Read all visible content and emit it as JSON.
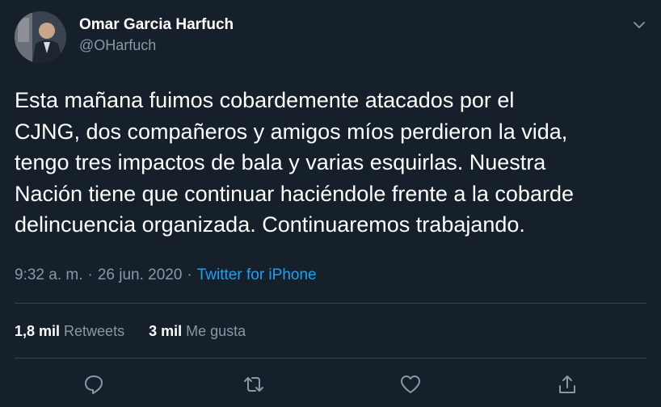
{
  "author": {
    "display_name": "Omar Garcia Harfuch",
    "handle": "@OHarfuch"
  },
  "tweet": {
    "text": "Esta mañana fuimos cobardemente atacados por el\nCJNG, dos compañeros y amigos míos perdieron la vida,\ntengo tres impactos de bala y varias esquirlas. Nuestra\nNación tiene que continuar haciéndole frente a la cobarde\ndelincuencia organizada. Continuaremos trabajando.",
    "time": "9:32 a. m.",
    "separator": "·",
    "date": "26 jun. 2020",
    "source": "Twitter for iPhone"
  },
  "stats": {
    "retweets_count": "1,8 mil",
    "retweets_label": "Retweets",
    "likes_count": "3 mil",
    "likes_label": "Me gusta"
  },
  "icons": {
    "caret": "chevron-down-icon",
    "reply": "reply-icon",
    "retweet": "retweet-icon",
    "like": "heart-icon",
    "share": "share-icon"
  },
  "colors": {
    "background": "#15202b",
    "secondary_text": "#8899a6",
    "link": "#1da1f2",
    "divider": "#38444d"
  }
}
